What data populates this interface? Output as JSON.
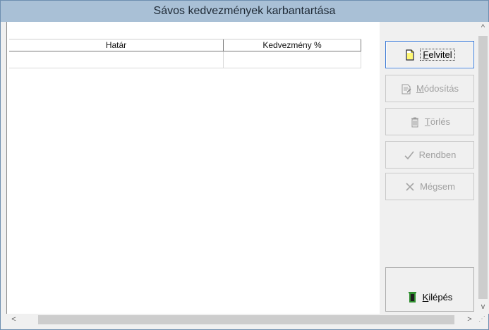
{
  "window": {
    "title": "Sávos kedvezmények karbantartása"
  },
  "grid": {
    "columns": [
      "Határ",
      "Kedvezmény %"
    ],
    "rows": [
      [
        "",
        ""
      ]
    ]
  },
  "buttons": {
    "felvitel": {
      "label": "Felvitel",
      "accel": "F",
      "rest": "elvitel",
      "enabled": true
    },
    "modositas": {
      "label": "Módosítás",
      "accel": "M",
      "rest": "ódosítás",
      "enabled": false
    },
    "torles": {
      "label": "Törlés",
      "accel": "T",
      "rest": "örlés",
      "enabled": false
    },
    "rendben": {
      "label": "Rendben",
      "enabled": false
    },
    "megsem": {
      "label": "Mégsem",
      "enabled": false
    },
    "kilepes": {
      "label": "Kilépés",
      "accel": "K",
      "rest": "ilépés",
      "enabled": true
    }
  },
  "icons": {
    "felvitel": "new-document-icon",
    "modositas": "edit-document-icon",
    "torles": "trash-icon",
    "rendben": "checkmark-icon",
    "megsem": "cross-icon",
    "kilepes": "exit-door-icon"
  },
  "scrollbars": {
    "up": "^",
    "down": "v",
    "left": "<",
    "right": ">"
  }
}
